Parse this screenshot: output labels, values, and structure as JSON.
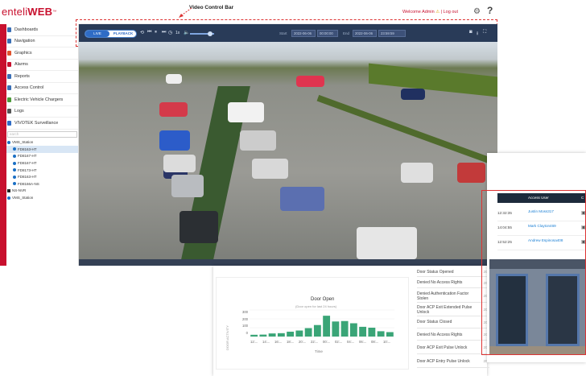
{
  "app": {
    "logo_main": "enteli",
    "logo_brand": "WEB",
    "logo_tm": "™"
  },
  "callout": {
    "label": "Video Control Bar"
  },
  "header": {
    "welcome_prefix": "Welcome",
    "user": "Admin",
    "separator": "|",
    "logout": "Log out",
    "help": "?"
  },
  "sidebar": {
    "items": [
      {
        "label": "Dashboards",
        "icon": "dashboard-icon",
        "color": "#3a6fb5"
      },
      {
        "label": "Navigation",
        "icon": "navigation-icon",
        "color": "#3a6fb5"
      },
      {
        "label": "Graphics",
        "icon": "graphics-icon",
        "color": "#e0532e"
      },
      {
        "label": "Alarms",
        "icon": "alarm-icon",
        "color": "#c8102e"
      },
      {
        "label": "Reports",
        "icon": "reports-icon",
        "color": "#3a6fb5"
      },
      {
        "label": "Access Control",
        "icon": "key-icon",
        "color": "#3a6fb5"
      },
      {
        "label": "Electric Vehicle Chargers",
        "icon": "charger-icon",
        "color": "#4c9a3a"
      },
      {
        "label": "Logs",
        "icon": "logs-icon",
        "color": "#555555"
      },
      {
        "label": "VIVOTEK Surveillance",
        "icon": "camera-icon",
        "color": "#2f6cc5"
      }
    ],
    "search_placeholder": "earch",
    "tree": [
      "VMS_Station",
      "FD8163-HT",
      "FD8167-HT",
      "FD8167-HT",
      "FD8173-HT",
      "FD8163-HT",
      "FD8166A-NS",
      "NS-NVR",
      "VMS_Station"
    ]
  },
  "controls": {
    "live": "LIVE",
    "playback": "PLAYBACK",
    "speed": "1x",
    "start_label": "Start",
    "start_date": "2022-06-06",
    "start_time": "00:00:00",
    "end_label": "End",
    "end_date": "2022-06-06",
    "end_time": "23:59:59"
  },
  "door_chart": {
    "title": "Door Open",
    "subtitle": "(Door open for last 24 hours)",
    "ylabel": "DOOR ACTIVITY",
    "xlabel": "Time",
    "yticks": [
      "300",
      "200",
      "100",
      "0"
    ]
  },
  "chart_data": {
    "type": "bar",
    "title": "Door Open",
    "subtitle": "(Door open for last 24 hours)",
    "xlabel": "Time",
    "ylabel": "DOOR ACTIVITY",
    "ylim": [
      0,
      300
    ],
    "tick_labels": [
      "12:...",
      "14:...",
      "16:...",
      "18:...",
      "20:...",
      "22:...",
      "00:...",
      "02:...",
      "04:...",
      "06:...",
      "08:...",
      "10:..."
    ],
    "values": [
      20,
      22,
      35,
      38,
      55,
      68,
      95,
      130,
      235,
      170,
      175,
      150,
      110,
      100,
      60,
      50
    ],
    "color": "#3aa577"
  },
  "events": [
    {
      "label": "Door Status Opened",
      "year": "202"
    },
    {
      "label": "Denied No Access Rights",
      "year": "202"
    },
    {
      "label": "Denied Authentication Factor Stolen",
      "year": "202"
    },
    {
      "label": "Door ACP Exit Extended Pulse Unlock",
      "year": "202"
    },
    {
      "label": "Door Status Closed",
      "year": "202"
    },
    {
      "label": "Denied No Access Rights",
      "year": "202"
    },
    {
      "label": "Door ACP Exit Pulse Unlock",
      "year": "202"
    },
    {
      "label": "Door ACP Entry Pulse Unlock",
      "year": "202"
    }
  ],
  "access_table": {
    "headers": [
      "Access User",
      "C"
    ],
    "rows": [
      {
        "time": "12:32:35",
        "user": "Justin Moss317"
      },
      {
        "time": "14:04:55",
        "user": "Mark Clayton469"
      },
      {
        "time": "12:52:25",
        "user": "Andrew Espinosa408"
      }
    ]
  },
  "colors": {
    "brand": "#c8102e",
    "toolbar": "#293b58",
    "accent": "#2f6cc5",
    "link": "#1a7fd4"
  }
}
